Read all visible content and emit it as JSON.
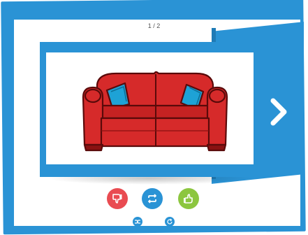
{
  "counter": {
    "text": "1 / 2"
  },
  "card": {
    "image_subject": "red-sofa-with-blue-cushions"
  },
  "actions": {
    "dislike_icon": "thumbs-down-icon",
    "flip_icon": "repeat-icon",
    "like_icon": "thumbs-up-icon",
    "shuffle_icon": "shuffle-icon",
    "restart_icon": "refresh-icon"
  },
  "colors": {
    "frame": "#2a93d5",
    "dislike": "#e94b51",
    "like": "#8cc63f",
    "sofa": "#d62a2a",
    "cushion": "#1ea2d6"
  }
}
